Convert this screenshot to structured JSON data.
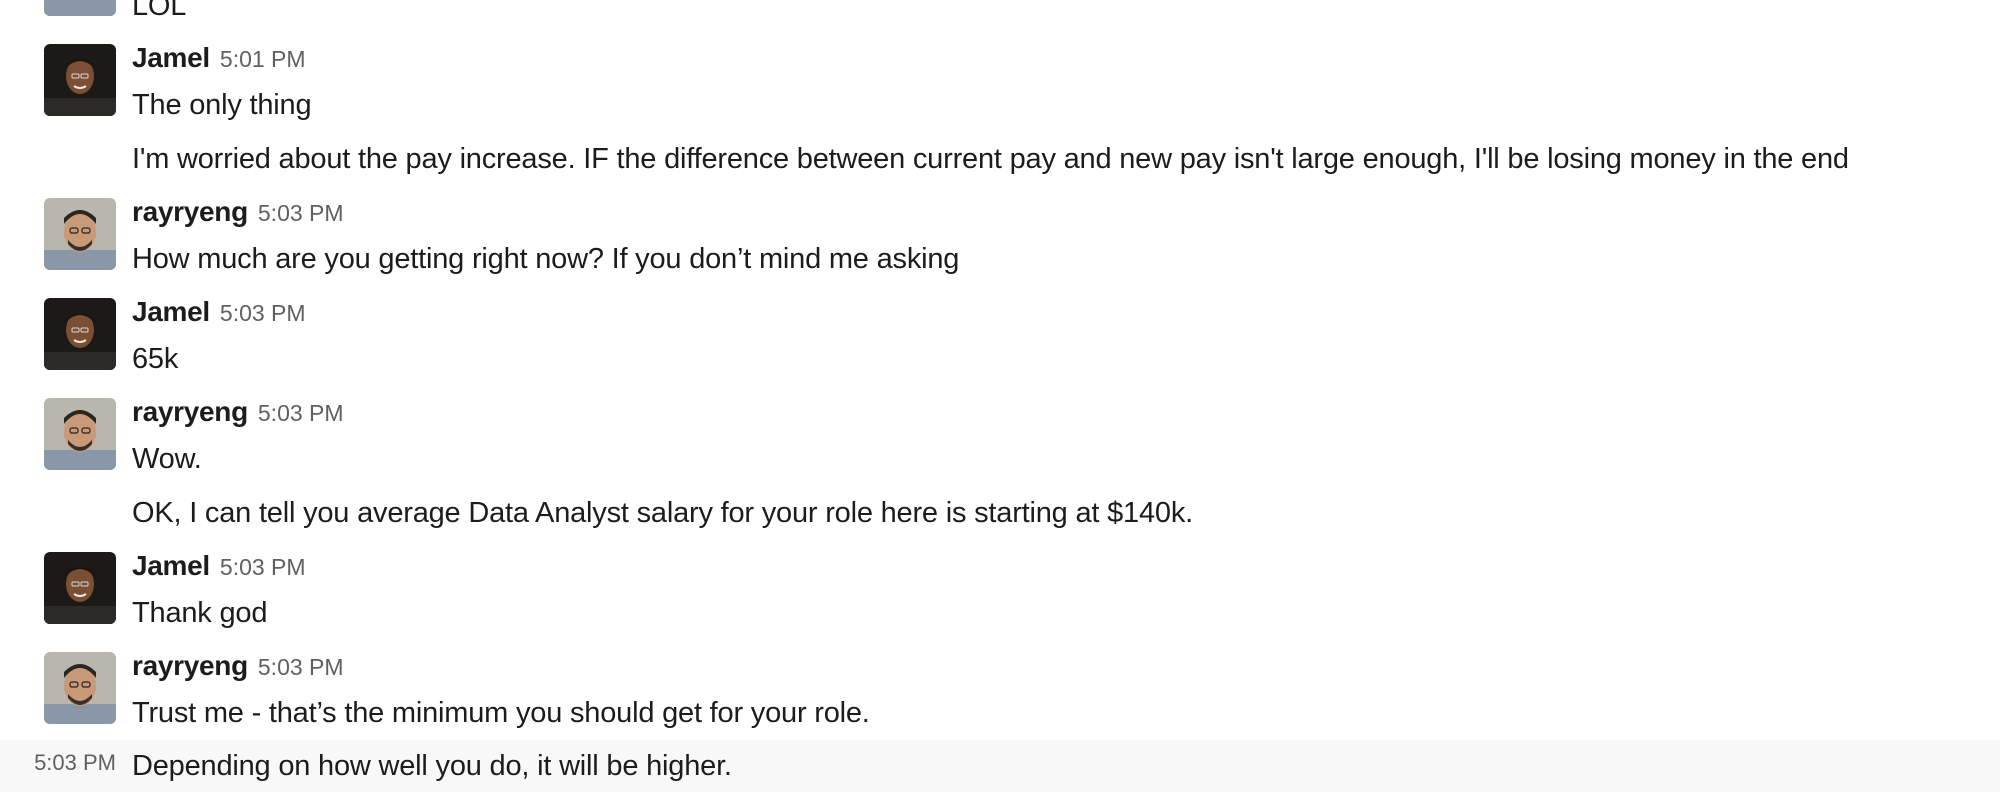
{
  "messages": [
    {
      "author": "",
      "time": "",
      "lines": [
        "LOL"
      ]
    },
    {
      "author": "Jamel",
      "time": "5:01 PM",
      "lines": [
        "The only thing",
        "I'm worried about the pay increase. IF the difference between current pay and new pay isn't large enough, I'll be losing money in the end"
      ]
    },
    {
      "author": "rayryeng",
      "time": "5:03 PM",
      "lines": [
        "How much are you getting right now? If you don’t mind me asking"
      ]
    },
    {
      "author": "Jamel",
      "time": "5:03 PM",
      "lines": [
        "65k"
      ]
    },
    {
      "author": "rayryeng",
      "time": "5:03 PM",
      "lines": [
        "Wow.",
        "OK, I can tell you average Data Analyst salary for your role here is starting at $140k."
      ]
    },
    {
      "author": "Jamel",
      "time": "5:03 PM",
      "lines": [
        "Thank god"
      ]
    },
    {
      "author": "rayryeng",
      "time": "5:03 PM",
      "lines": [
        "Trust me - that’s the minimum you should get for your role."
      ]
    },
    {
      "author": "",
      "time": "5:03 PM",
      "lines": [
        "Depending on how well you do, it will be higher."
      ]
    }
  ],
  "colors": {
    "text": "#1d1c1d",
    "timestamp": "#616061",
    "hover_background": "#f8f8f8"
  },
  "icons": {
    "jamel_avatar": "jamel-avatar",
    "rayryeng_avatar": "rayryeng-avatar"
  }
}
